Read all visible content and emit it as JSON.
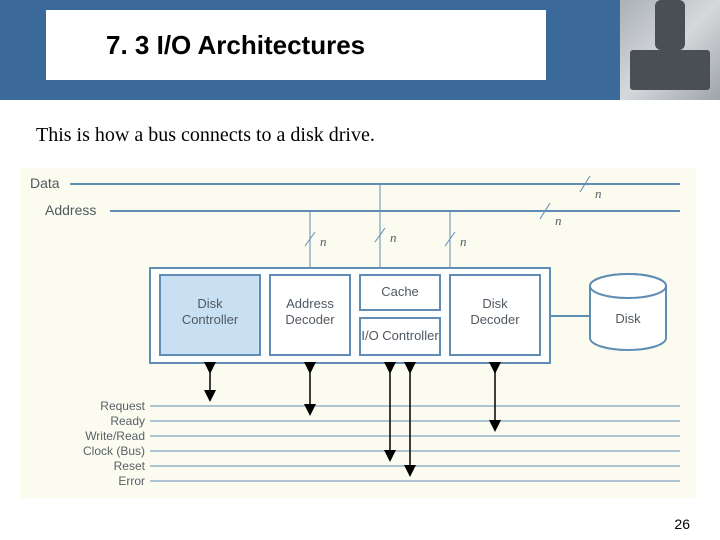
{
  "header": {
    "title": "7. 3 I/O Architectures"
  },
  "caption": "This is how a bus connects to a disk drive.",
  "page_number": "26",
  "diagram": {
    "buses": {
      "data": "Data",
      "address": "Address",
      "n": "n"
    },
    "blocks": {
      "disk_controller": "Disk\nController",
      "address_decoder": "Address\nDecoder",
      "cache": "Cache",
      "io_controller": "I/O Controller",
      "disk_decoder": "Disk\nDecoder",
      "disk": "Disk"
    },
    "signals": {
      "request": "Request",
      "ready": "Ready",
      "write_read": "Write/Read",
      "clock_bus": "Clock (Bus)",
      "reset": "Reset",
      "error": "Error"
    }
  }
}
